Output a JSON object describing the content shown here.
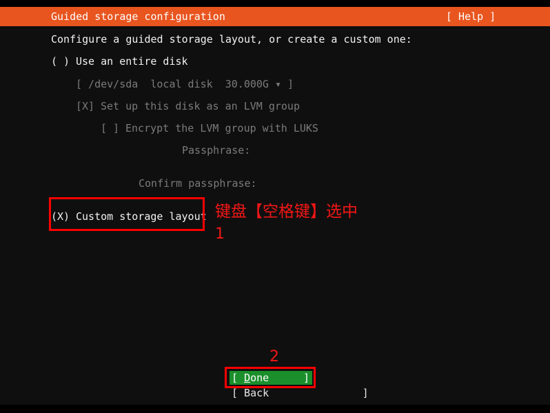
{
  "window": {
    "title": "Guided storage configuration",
    "help_label": "[ Help ]"
  },
  "colors": {
    "header_bg": "#e8551f",
    "terminal_bg": "#100f0f",
    "text": "#e6e6e6",
    "dim_text": "#7b7b7b",
    "annotation_red": "#ff0000",
    "button_selected_bg": "#1b8f2c"
  },
  "main": {
    "prompt": "Configure a guided storage layout, or create a custom one:",
    "options": [
      {
        "marker": "( )",
        "label": "Use an entire disk",
        "state": "unselected",
        "dim": false
      },
      {
        "marker": "",
        "label": "[ /dev/sda  local disk  30.000G ▾ ]",
        "state": "dropdown",
        "dim": true
      },
      {
        "marker": "[X]",
        "label": "Set up this disk as an LVM group",
        "state": "checked",
        "dim": true
      },
      {
        "marker": "[ ]",
        "label": "Encrypt the LVM group with LUKS",
        "state": "unchecked",
        "dim": true
      }
    ],
    "passphrase_label": "Passphrase:",
    "confirm_passphrase_label": "Confirm passphrase:",
    "custom_option": {
      "marker": "(X)",
      "label": "Custom storage layout",
      "state": "selected",
      "dim": false
    }
  },
  "buttons": {
    "done_open_bracket": "[ ",
    "done_label_first": "D",
    "done_label_rest": "one",
    "done_close_bracket": "]",
    "done_full": "[ Done                ]",
    "back_full": "[ Back               ]"
  },
  "annotations": {
    "instruction_cn": "键盘【空格键】选中",
    "step_one": "1",
    "step_two": "2"
  }
}
